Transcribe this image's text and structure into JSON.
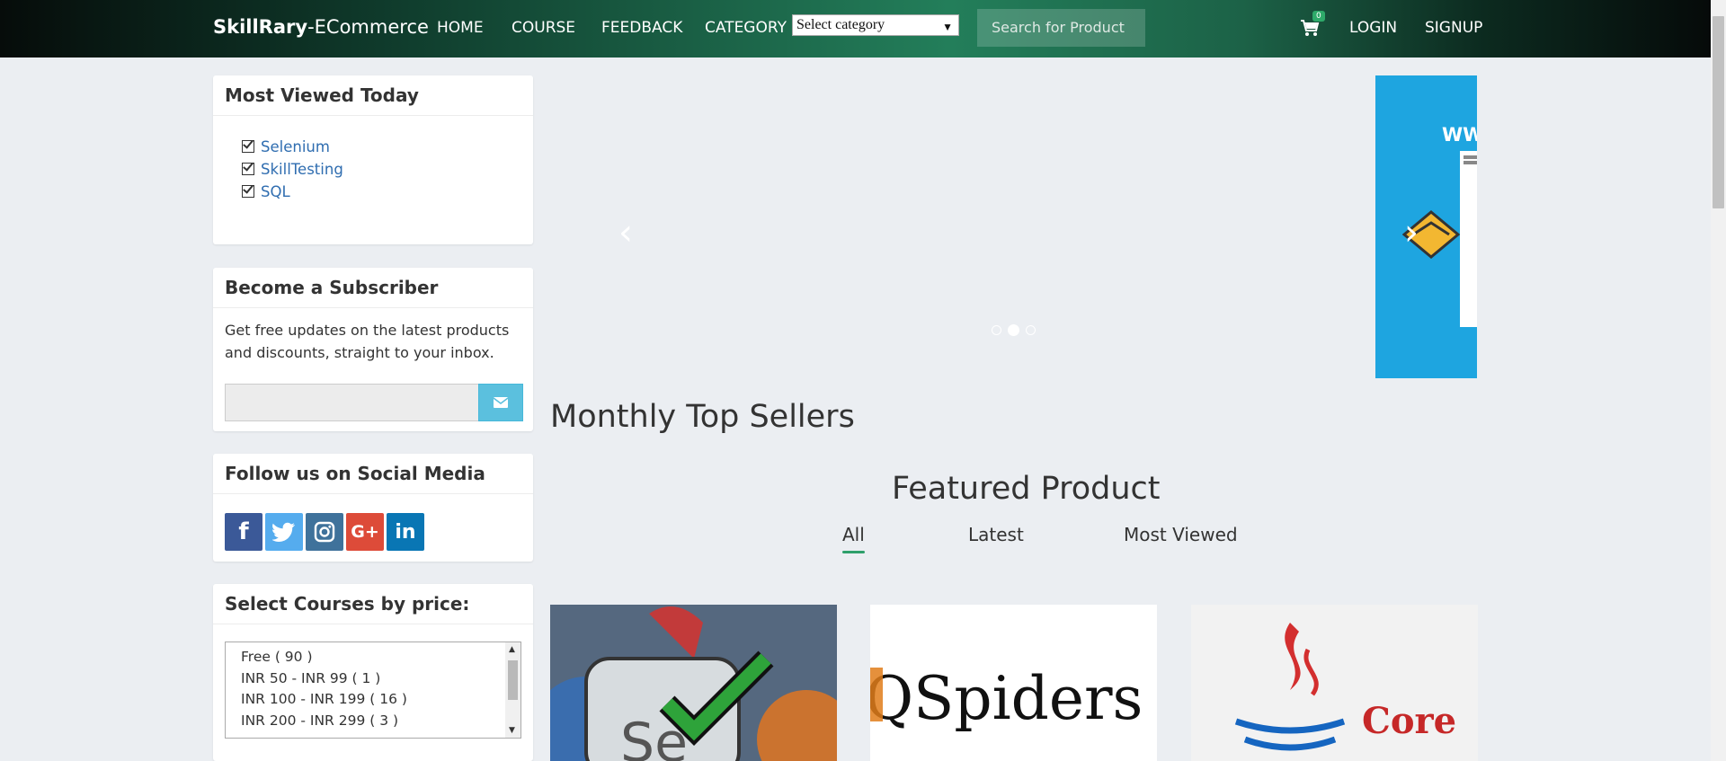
{
  "navbar": {
    "brand_bold": "SkillRary",
    "brand_rest": "-ECommerce",
    "links": [
      "HOME",
      "COURSE",
      "FEEDBACK",
      "CATEGORY"
    ],
    "category_select": "Select category",
    "search_placeholder": "Search for Product",
    "cart_count": "0",
    "login": "LOGIN",
    "signup": "SIGNUP"
  },
  "sidebar": {
    "most_viewed": {
      "title": "Most Viewed Today",
      "items": [
        "Selenium",
        "SkillTesting",
        "SQL"
      ]
    },
    "subscriber": {
      "title": "Become a Subscriber",
      "text": "Get free updates on the latest products and discounts, straight to your inbox."
    },
    "social": {
      "title": "Follow us on Social Media",
      "icons": [
        "facebook-icon",
        "twitter-icon",
        "instagram-icon",
        "google-plus-icon",
        "linkedin-icon"
      ]
    },
    "price": {
      "title": "Select Courses by price:",
      "options": [
        "Free ( 90 )",
        "INR 50 - INR 99 ( 1 )",
        "INR 100 - INR 199 ( 16 )",
        "INR 200 - INR 299 ( 3 )"
      ]
    }
  },
  "carousel": {
    "ad_text": "WW",
    "active_slide_index": 1
  },
  "main": {
    "monthly_title": "Monthly Top Sellers",
    "featured_title": "Featured Product",
    "tabs": [
      "All",
      "Latest",
      "Most Viewed"
    ],
    "active_tab": "All",
    "cards": [
      {
        "name": "selenium-card",
        "label": "Se"
      },
      {
        "name": "qspiders-card",
        "label": "QSpiders"
      },
      {
        "name": "core-java-card",
        "label": "Core"
      }
    ]
  },
  "colors": {
    "accent": "#2e9f6b",
    "link": "#2f6db0",
    "subscribe_btn": "#5bc0de",
    "facebook": "#3b5998",
    "twitter": "#55acee",
    "instagram": "#3f729b",
    "google_plus": "#dd4b39",
    "linkedin": "#0976b4"
  }
}
